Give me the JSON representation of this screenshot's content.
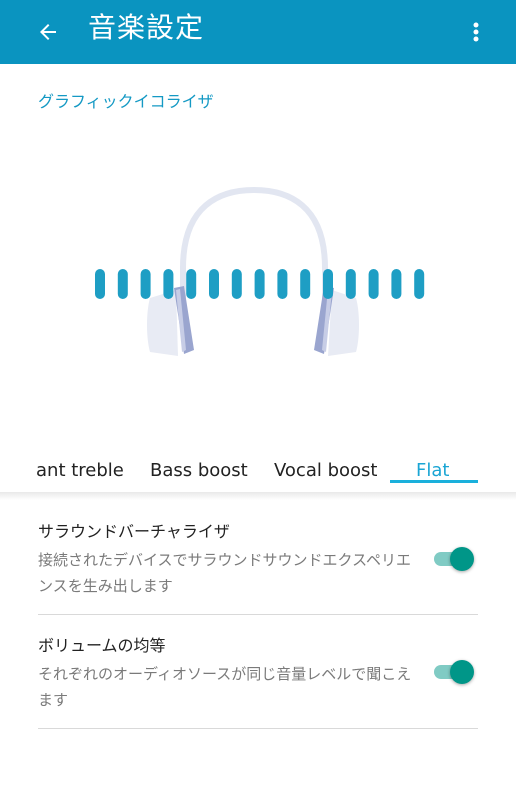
{
  "header": {
    "title": "音楽設定",
    "back_icon": "arrow-left-icon",
    "menu_icon": "more-vert-icon",
    "color": "#0a94c0"
  },
  "equalizer": {
    "section_label": "グラフィックイコライザ",
    "levels": [
      0.5,
      0.5,
      0.5,
      0.5,
      0.5,
      0.5,
      0.5,
      0.5,
      0.5,
      0.5,
      0.5,
      0.5,
      0.5,
      0.5,
      0.5
    ]
  },
  "presets": {
    "tabs": [
      "ant treble",
      "Bass boost",
      "Vocal boost",
      "Flat"
    ],
    "selected": "Flat"
  },
  "settings": [
    {
      "title": "サラウンドバーチャライザ",
      "description": "接続されたデバイスでサラウンドサウンドエクスペリエンスを生み出します",
      "enabled": true
    },
    {
      "title": "ボリュームの均等",
      "description": "それぞれのオーディオソースが同じ音量レベルで聞こえます",
      "enabled": true
    }
  ],
  "colors": {
    "accent": "#1499c4",
    "bars": "#1e9ec4",
    "toggle_thumb": "#009688",
    "toggle_track": "#80cbc4"
  }
}
